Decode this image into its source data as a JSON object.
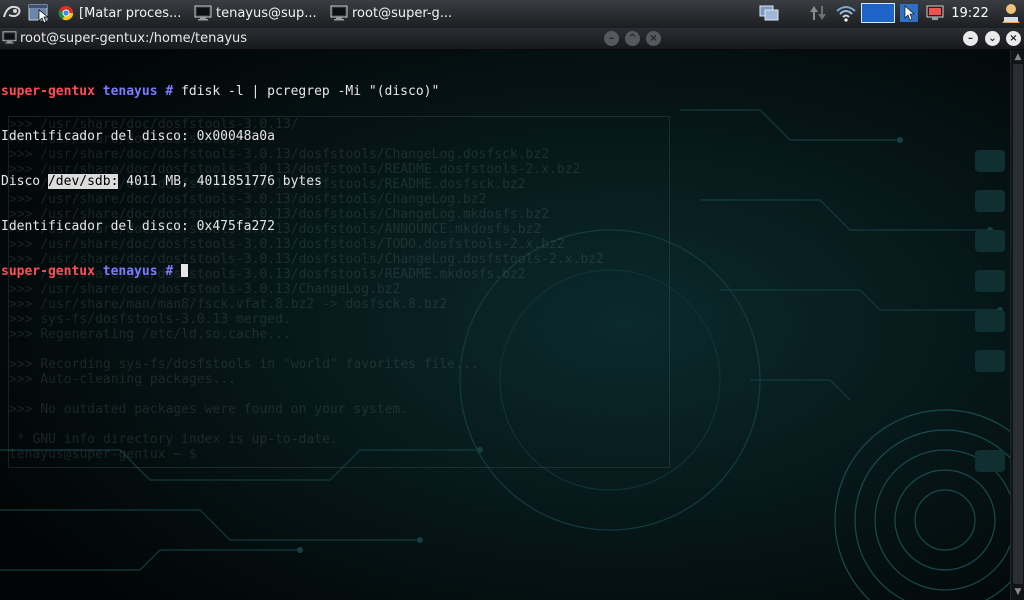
{
  "taskbar": {
    "tasks": [
      {
        "label": "[Matar proces...",
        "icon": "chrome-icon"
      },
      {
        "label": "tenayus@sup...",
        "icon": "terminal-icon"
      },
      {
        "label": "root@super-g...",
        "icon": "terminal-icon"
      }
    ],
    "tray_icons": [
      "window-list-icon",
      "network-transfer-icon",
      "wifi-icon",
      "battery-bar-icon",
      "pointer-icon",
      "display-icon",
      "user-icon"
    ],
    "clock": "19:22"
  },
  "window": {
    "title": "root@super-gentux:/home/tenayus",
    "icon": "terminal-icon",
    "buttons": {
      "minimize": "minimize-icon",
      "maximize": "maximize-icon",
      "close": "close-icon"
    }
  },
  "terminal": {
    "line1": {
      "user": "super-gentux",
      "host": "tenayus",
      "symbol": " #",
      "command": " fdisk -l | pcregrep -Mi \"(disco)\""
    },
    "line2": "Identificador del disco: 0x00048a0a",
    "line3": {
      "before": "Disco ",
      "highlight": "/dev/sdb:",
      "after": " 4011 MB, 4011851776 bytes"
    },
    "line4": "Identificador del disco: 0x475fa272",
    "line5": {
      "user": "super-gentux",
      "host": "tenayus",
      "symbol": " #",
      "command": " "
    }
  },
  "background_terminal": {
    "lines": [
      ">>> /usr/share/doc/dosfstools-3.0.13/",
      ">>> /usr/share/doc/dosfstools/",
      ">>> /usr/share/doc/dosfstools-3.0.13/dosfstools/ChangeLog.dosfsck.bz2",
      ">>> /usr/share/doc/dosfstools-3.0.13/dosfstools/README.dosfstools-2.x.bz2",
      ">>> /usr/share/doc/dosfstools-3.0.13/dosfstools/README.dosfsck.bz2",
      ">>> /usr/share/doc/dosfstools-3.0.13/dosfstools/ChangeLog.bz2",
      ">>> /usr/share/doc/dosfstools-3.0.13/dosfstools/ChangeLog.mkdosfs.bz2",
      ">>> /usr/share/doc/dosfstools-3.0.13/dosfstools/ANNOUNCE.mkdosfs.bz2",
      ">>> /usr/share/doc/dosfstools-3.0.13/dosfstools/TODO.dosfstools-2.x.bz2",
      ">>> /usr/share/doc/dosfstools-3.0.13/dosfstools/ChangeLog.dosfstools-2.x.bz2",
      ">>> /usr/share/doc/dosfstools-3.0.13/dosfstools/README.mkdosfs.bz2",
      ">>> /usr/share/doc/dosfstools-3.0.13/ChangeLog.bz2",
      ">>> /usr/share/man/man8/fsck.vfat.8.bz2 -> dosfsck.8.bz2",
      ">>> sys-fs/dosfstools-3.0.13 merged.",
      ">>> Regenerating /etc/ld.so.cache...",
      "",
      ">>> Recording sys-fs/dosfstools in \"world\" favorites file...",
      ">>> Auto-cleaning packages...",
      "",
      ">>> No outdated packages were found on your system.",
      "",
      " * GNU info directory index is up-to-date.",
      "tenayus@super-gentux ~ $ "
    ]
  }
}
